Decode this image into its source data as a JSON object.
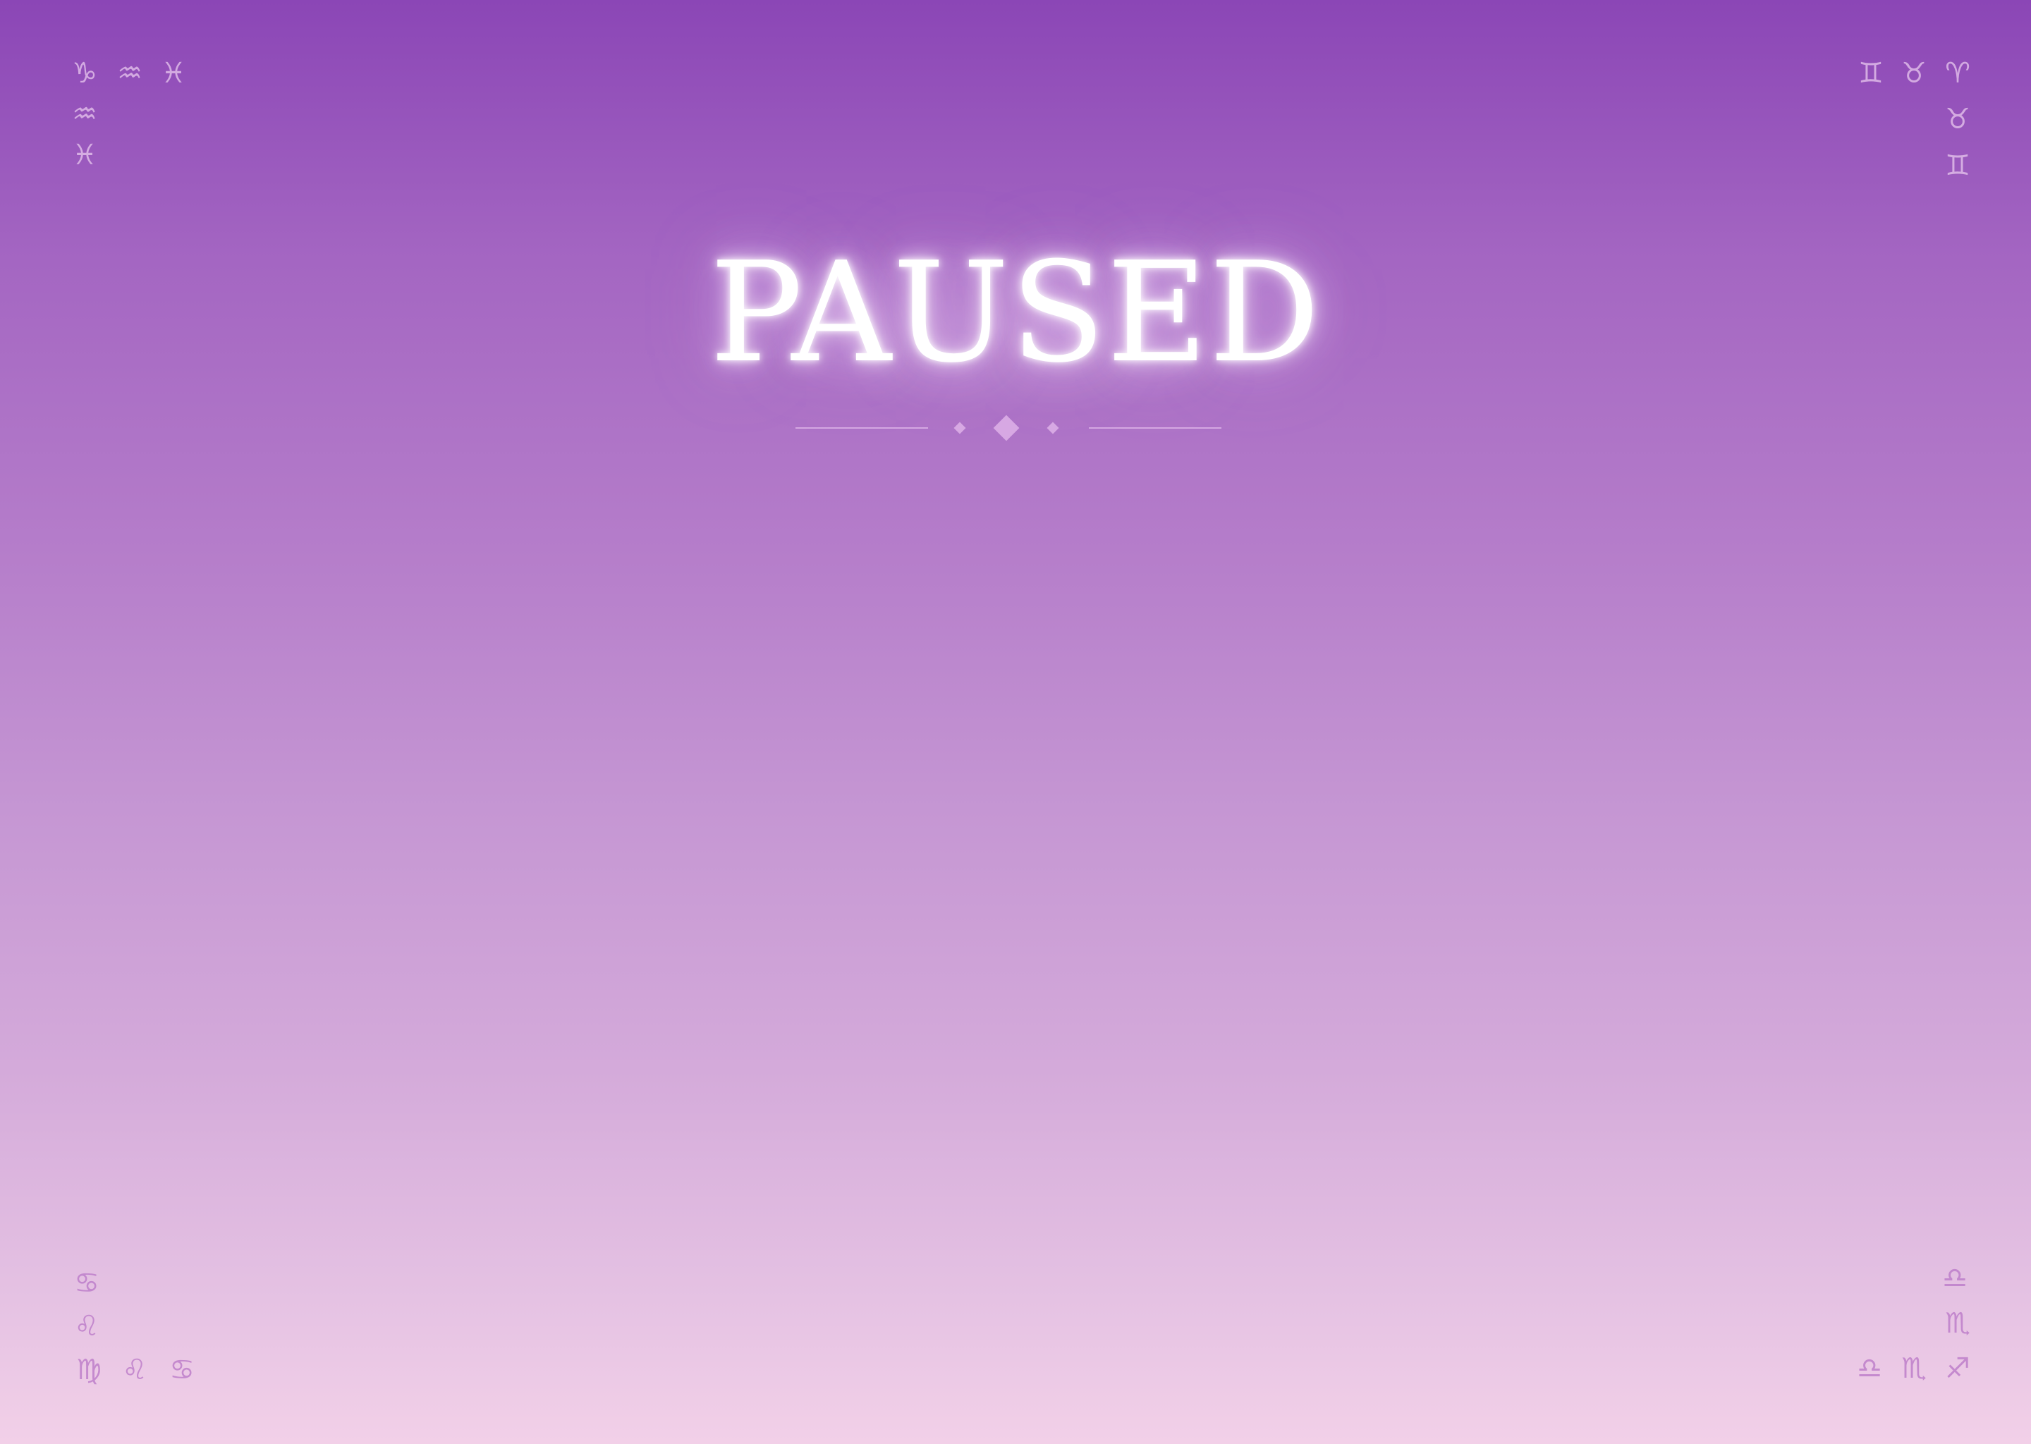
{
  "screen": {
    "title": "PAUSED"
  },
  "colors": {
    "gradient_top": "#8b46b6",
    "gradient_bottom": "#f2d0e8",
    "title_color": "#ffffff",
    "ornament_color": "#deb2e8"
  },
  "corners": {
    "top_left": [
      "♑",
      "♒",
      "♓",
      "♒",
      "♓"
    ],
    "top_right": [
      "♊",
      "♉",
      "♈",
      "♉",
      "♊"
    ],
    "bottom_left": [
      "♋",
      "♌",
      "♍",
      "♌",
      "♋"
    ],
    "bottom_right": [
      "♎",
      "♏",
      "♎",
      "♏",
      "♐"
    ]
  }
}
